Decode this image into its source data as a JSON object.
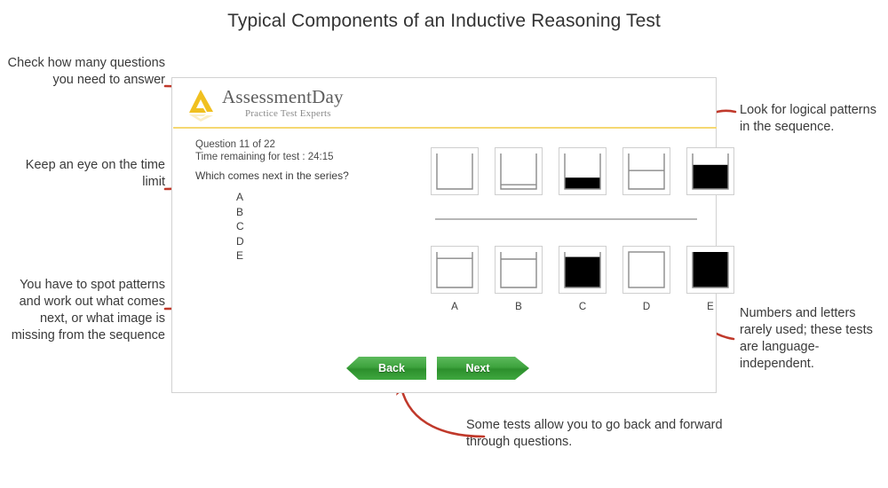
{
  "page": {
    "title": "Typical Components of an Inductive Reasoning Test"
  },
  "annotations": {
    "questions_count": "Check how many questions you need to answer",
    "time_limit": "Keep an eye on the time limit",
    "spot_patterns": "You have to spot patterns and work out what comes next, or what image is missing from the sequence",
    "logical_patterns": "Look for logical patterns in the sequence.",
    "language_independent": "Numbers and letters rarely used; these tests are language-independent.",
    "back_forward": "Some tests allow you to go back and forward through questions."
  },
  "test_panel": {
    "brand": {
      "name": "AssessmentDay",
      "tagline": "Practice Test Experts",
      "logo_icon": "assessmentday-logo-icon",
      "logo_color": "#f0c020"
    },
    "header_rule_color": "#f5d872",
    "question_number": "Question 11 of 22",
    "time_remaining": "Time remaining for test : 24:15",
    "prompt": "Which comes next in the series?",
    "option_letters": [
      "A",
      "B",
      "C",
      "D",
      "E"
    ],
    "sequence": [
      {
        "name": "sequence-shape-1",
        "type": "container",
        "fill_fraction": 0.0,
        "line_fraction": null
      },
      {
        "name": "sequence-shape-2",
        "type": "container",
        "fill_fraction": 0.0,
        "line_fraction": 0.12
      },
      {
        "name": "sequence-shape-3",
        "type": "container",
        "fill_fraction": 0.32,
        "line_fraction": null
      },
      {
        "name": "sequence-shape-4",
        "type": "container",
        "fill_fraction": 0.0,
        "line_fraction": 0.52
      },
      {
        "name": "sequence-shape-5",
        "type": "container",
        "fill_fraction": 0.68,
        "line_fraction": null
      }
    ],
    "answers": [
      {
        "label": "A",
        "type": "container",
        "fill_fraction": 0.0,
        "line_fraction": 0.82
      },
      {
        "label": "B",
        "type": "container",
        "fill_fraction": 0.0,
        "line_fraction": 0.8
      },
      {
        "label": "C",
        "type": "container",
        "fill_fraction": 0.86,
        "line_fraction": null
      },
      {
        "label": "D",
        "type": "box",
        "fill_fraction": 0.0,
        "line_fraction": null
      },
      {
        "label": "E",
        "type": "container",
        "fill_fraction": 1.0,
        "line_fraction": null
      }
    ],
    "buttons": {
      "back": "Back",
      "next": "Next",
      "color": "#3ea33e"
    }
  },
  "colors": {
    "arrow": "#c0392b",
    "panel_border": "#d2d2d2",
    "divider": "#b6b6b6",
    "shape_stroke": "#8a8a8a",
    "shape_fill": "#000000"
  }
}
